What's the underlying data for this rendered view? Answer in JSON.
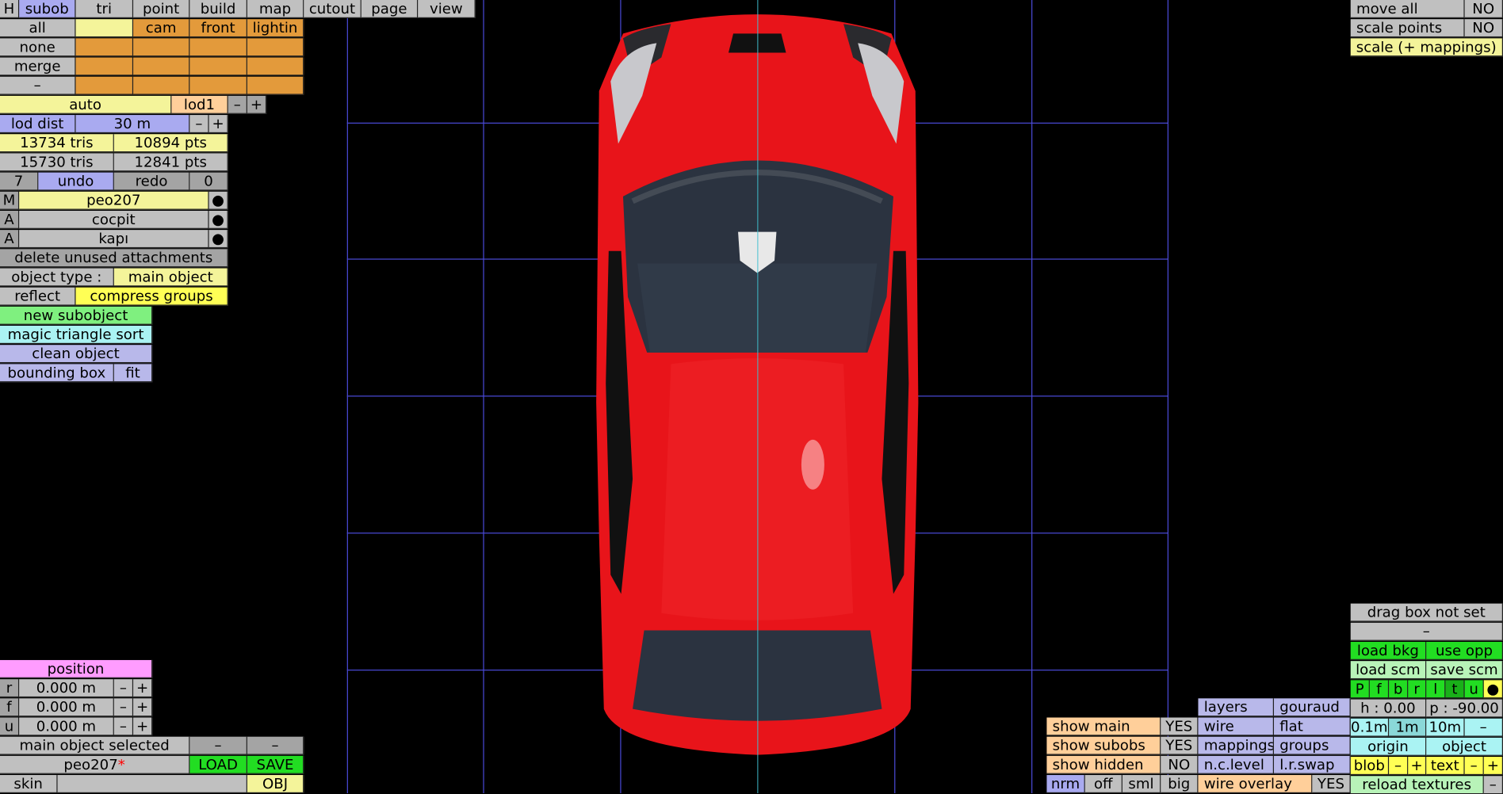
{
  "menu": {
    "h": "H",
    "subob": "subob",
    "tri": "tri",
    "point": "point",
    "build": "build",
    "map": "map",
    "cutout": "cutout",
    "page": "page",
    "view": "view"
  },
  "select": {
    "all": "all",
    "none": "none",
    "merge": "merge",
    "dash": "–",
    "cam": "cam",
    "front": "front",
    "lightin": "lightin"
  },
  "lod": {
    "auto": "auto",
    "level": "lod1",
    "minus": "–",
    "plus": "+",
    "dist_label": "lod dist",
    "dist_value": "30 m"
  },
  "stats": {
    "tris1": "13734 tris",
    "pts1": "10894 pts",
    "tris2": "15730 tris",
    "pts2": "12841 pts"
  },
  "history": {
    "count": "7",
    "undo": "undo",
    "redo": "redo",
    "redo_count": "0"
  },
  "objects": [
    {
      "tag": "M",
      "name": "peo207",
      "dot": "●"
    },
    {
      "tag": "A",
      "name": "cocpit",
      "dot": "●"
    },
    {
      "tag": "A",
      "name": "kapı",
      "dot": "●"
    }
  ],
  "tools": {
    "delete_unused": "delete unused attachments",
    "object_type_label": "object type :",
    "object_type_value": "main object",
    "reflect": "reflect",
    "compress": "compress groups",
    "new_subobject": "new subobject",
    "magic_sort": "magic triangle sort",
    "clean": "clean object",
    "bounding": "bounding box",
    "fit": "fit"
  },
  "position": {
    "title": "position",
    "rows": [
      {
        "axis": "r",
        "value": "0.000 m"
      },
      {
        "axis": "f",
        "value": "0.000 m"
      },
      {
        "axis": "u",
        "value": "0.000 m"
      }
    ],
    "minus": "–",
    "plus": "+"
  },
  "status": {
    "selected": "main object selected",
    "dash": "–",
    "filename": "peo207",
    "modified": "*",
    "load": "LOAD",
    "save": "SAVE",
    "skin": "skin",
    "obj": "OBJ"
  },
  "top_right": {
    "move_all": "move all",
    "move_all_value": "NO",
    "scale_points": "scale points",
    "scale_points_value": "NO",
    "scale_mappings": "scale (+ mappings)"
  },
  "right_panel": {
    "drag_box": "drag box not set",
    "dash": "–",
    "load_bkg": "load bkg",
    "use_opp": "use opp",
    "load_scm": "load scm",
    "save_scm": "save scm",
    "views": [
      "P",
      "f",
      "b",
      "r",
      "l",
      "t",
      "u",
      "●"
    ],
    "h": "h : 0.00",
    "p": "p : -90.00",
    "grid": [
      "0.1m",
      "1m",
      "10m",
      "–"
    ],
    "origin": "origin",
    "object": "object",
    "blob": "blob",
    "minus": "–",
    "plus": "+",
    "text": "text",
    "reload": "reload textures"
  },
  "display": {
    "layers": "layers",
    "gouraud": "gouraud",
    "show_main": "show main",
    "show_main_v": "YES",
    "wire": "wire",
    "flat": "flat",
    "show_subobs": "show subobs",
    "show_subobs_v": "YES",
    "mappings": "mappings",
    "groups": "groups",
    "show_hidden": "show hidden",
    "show_hidden_v": "NO",
    "nclevel": "n.c.level",
    "lrswap": "l.r.swap",
    "nrm": "nrm",
    "off": "off",
    "sml": "sml",
    "big": "big",
    "wire_overlay": "wire overlay",
    "wire_overlay_v": "YES"
  },
  "colors": {
    "car_body": "#e8141a",
    "grid_line": "#4a4ad8",
    "axis_line": "#40c0d0"
  }
}
